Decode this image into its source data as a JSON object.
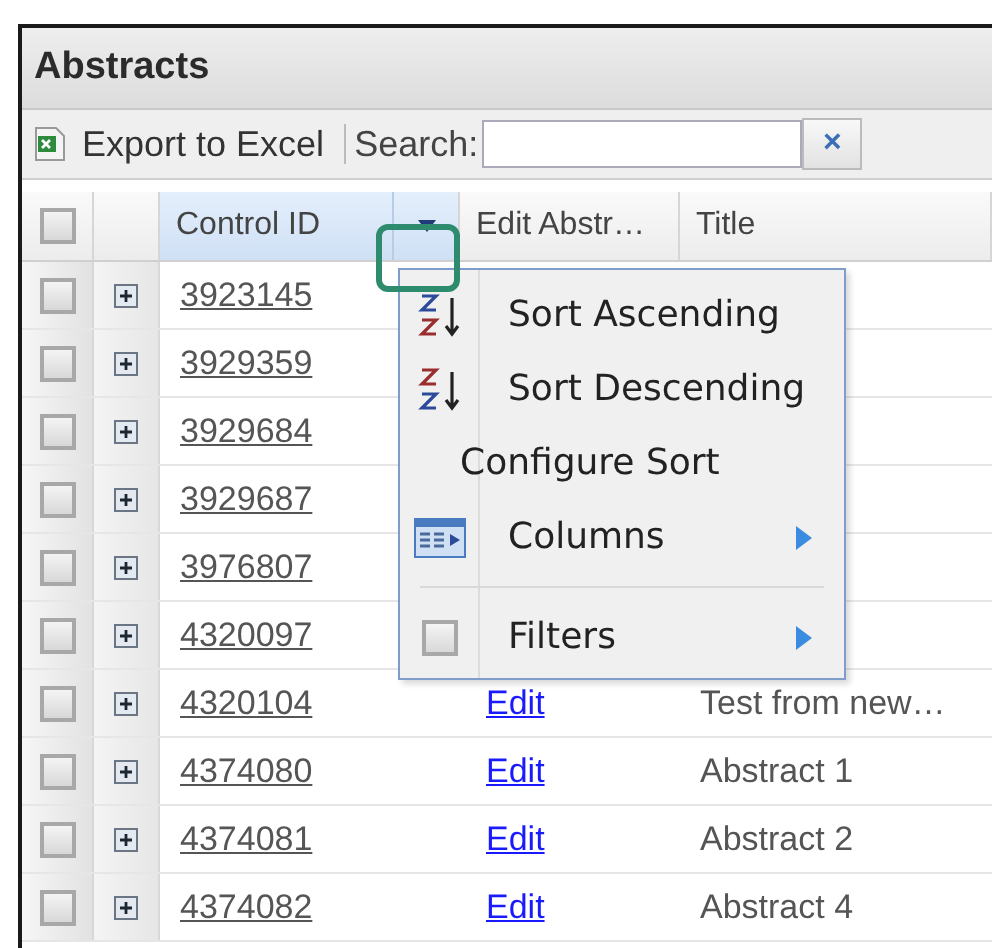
{
  "window": {
    "title": "Abstracts"
  },
  "toolbar": {
    "export_label": "Export to Excel",
    "search_label": "Search:",
    "clear_button": "×"
  },
  "table": {
    "header_checkbox": {
      "checked": false
    },
    "columns": [
      "Control ID",
      "Edit Abstr…",
      "Title"
    ],
    "sort_column_menu_open": true,
    "rows": [
      {
        "checked": false,
        "control_id": "3923145"
      },
      {
        "checked": false,
        "control_id": "3929359"
      },
      {
        "checked": false,
        "control_id": "3929684"
      },
      {
        "checked": false,
        "control_id": "3929687"
      },
      {
        "checked": false,
        "control_id": "3976807"
      },
      {
        "checked": false,
        "control_id": "4320097"
      },
      {
        "checked": false,
        "control_id": "4320104",
        "edit": "Edit",
        "title": "Test from new…"
      },
      {
        "checked": false,
        "control_id": "4374080",
        "edit": "Edit",
        "title": "Abstract 1"
      },
      {
        "checked": false,
        "control_id": "4374081",
        "edit": "Edit",
        "title": "Abstract 2"
      },
      {
        "checked": false,
        "control_id": "4374082",
        "edit": "Edit",
        "title": "Abstract 4"
      }
    ]
  },
  "column_menu": {
    "items": [
      {
        "kind": "sort-asc",
        "label": "Sort Ascending"
      },
      {
        "kind": "sort-desc",
        "label": "Sort Descending"
      },
      {
        "kind": "plain",
        "label": "Configure Sort"
      },
      {
        "kind": "columns",
        "label": "Columns",
        "submenu": true
      },
      {
        "kind": "check",
        "label": "Filters",
        "checked": false,
        "submenu": true,
        "separator_before": true
      }
    ]
  }
}
